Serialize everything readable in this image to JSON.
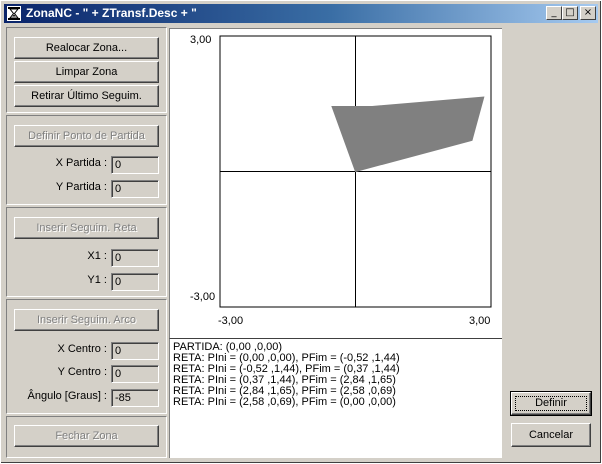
{
  "window": {
    "title": "ZonaNC - \" + ZTransf.Desc + \"",
    "minimize": "_",
    "maximize": "□",
    "close": "×"
  },
  "left_panel": {
    "realocar": "Realocar Zona...",
    "limpar": "Limpar Zona",
    "retirar": "Retirar Último Seguim.",
    "definir_ponto": "Definir Ponto de Partida",
    "x_partida_label": "X Partida :",
    "x_partida_value": "0",
    "y_partida_label": "Y Partida :",
    "y_partida_value": "0",
    "inserir_reta": "Inserir Seguim. Reta",
    "x1_label": "X1 :",
    "x1_value": "0",
    "y1_label": "Y1 :",
    "y1_value": "0",
    "inserir_arco": "Inserir Seguim. Arco",
    "x_centro_label": "X Centro :",
    "x_centro_value": "0",
    "y_centro_label": "Y Centro :",
    "y_centro_value": "0",
    "angulo_label": "Ângulo [Graus] :",
    "angulo_value": "-85",
    "fechar": "Fechar Zona"
  },
  "chart_data": {
    "type": "area",
    "xlim": [
      -3.0,
      3.0
    ],
    "ylim": [
      -3.0,
      3.0
    ],
    "tick_labels": {
      "y_top": "3,00",
      "y_bottom": "-3,00",
      "x_left": "-3,00",
      "x_right": "3,00"
    },
    "polygon": [
      {
        "x": 0.0,
        "y": 0.0
      },
      {
        "x": -0.52,
        "y": 1.44
      },
      {
        "x": 0.37,
        "y": 1.44
      },
      {
        "x": 2.84,
        "y": 1.65
      },
      {
        "x": 2.58,
        "y": 0.69
      },
      {
        "x": 0.0,
        "y": 0.0
      }
    ],
    "fill_color": "#808080",
    "axis_color": "#000000"
  },
  "log": [
    "PARTIDA: (0,00 ,0,00)",
    "RETA: PIni = (0,00 ,0,00),  PFim = (-0,52 ,1,44)",
    "RETA: PIni = (-0,52 ,1,44),  PFim = (0,37 ,1,44)",
    "RETA: PIni = (0,37 ,1,44),  PFim = (2,84 ,1,65)",
    "RETA: PIni = (2,84 ,1,65),  PFim = (2,58 ,0,69)",
    "RETA: PIni = (2,58 ,0,69),  PFim = (0,00 ,0,00)"
  ],
  "right_panel": {
    "definir": "Definir",
    "cancelar": "Cancelar"
  }
}
